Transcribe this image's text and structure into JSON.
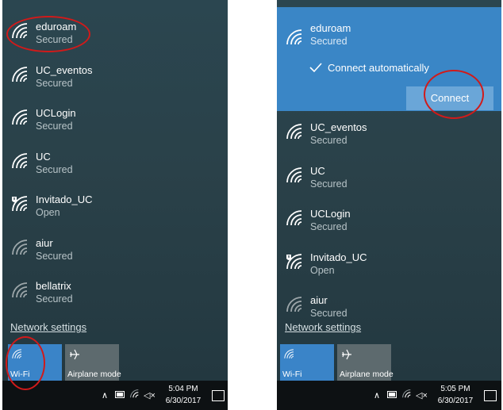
{
  "left": {
    "networks": [
      {
        "name": "eduroam",
        "status": "Secured",
        "open": false,
        "dim": false
      },
      {
        "name": "UC_eventos",
        "status": "Secured",
        "open": false,
        "dim": false
      },
      {
        "name": "UCLogin",
        "status": "Secured",
        "open": false,
        "dim": false
      },
      {
        "name": "UC",
        "status": "Secured",
        "open": false,
        "dim": false
      },
      {
        "name": "Invitado_UC",
        "status": "Open",
        "open": true,
        "dim": false
      },
      {
        "name": "aiur",
        "status": "Secured",
        "open": false,
        "dim": true
      },
      {
        "name": "bellatrix",
        "status": "Secured",
        "open": false,
        "dim": true
      }
    ],
    "network_settings": "Network settings",
    "tiles": {
      "wifi": "Wi-Fi",
      "airplane": "Airplane mode"
    },
    "clock": {
      "time": "5:04 PM",
      "date": "6/30/2017"
    }
  },
  "right": {
    "selected": {
      "name": "eduroam",
      "status": "Secured",
      "auto_label": "Connect automatically",
      "connect_label": "Connect"
    },
    "networks": [
      {
        "name": "UC_eventos",
        "status": "Secured",
        "open": false,
        "dim": false
      },
      {
        "name": "UC",
        "status": "Secured",
        "open": false,
        "dim": false
      },
      {
        "name": "UCLogin",
        "status": "Secured",
        "open": false,
        "dim": false
      },
      {
        "name": "Invitado_UC",
        "status": "Open",
        "open": true,
        "dim": false
      },
      {
        "name": "aiur",
        "status": "Secured",
        "open": false,
        "dim": true
      }
    ],
    "network_settings": "Network settings",
    "tiles": {
      "wifi": "Wi-Fi",
      "airplane": "Airplane mode"
    },
    "clock": {
      "time": "5:05 PM",
      "date": "6/30/2017"
    }
  },
  "colors": {
    "accent": "#3a86c6",
    "annotation": "#d11a1a",
    "background": "#243a42"
  },
  "icons": {
    "network": "wifi-signal-icon",
    "open_network": "wifi-shield-icon",
    "check": "checkmark-icon",
    "airplane": "airplane-icon"
  }
}
